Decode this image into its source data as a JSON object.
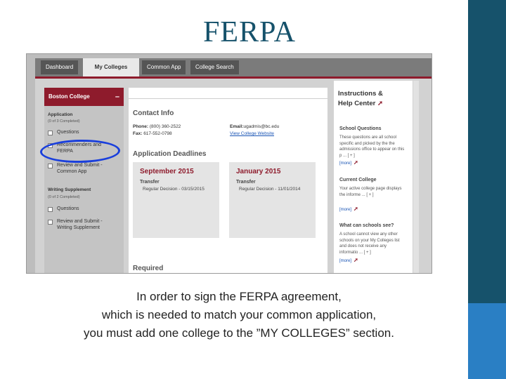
{
  "slide": {
    "title": "FERPA",
    "caption": [
      "In order to sign the FERPA agreement,",
      "which is needed to match your common application,",
      "you must add one college to the ”MY COLLEGES” section."
    ]
  },
  "nav": {
    "tabs": [
      "Dashboard",
      "My Colleges",
      "Common App",
      "College Search"
    ],
    "active_tab": "My Colleges"
  },
  "sidebar": {
    "college": "Boston College",
    "collapse_symbol": "–",
    "sections": [
      {
        "heading": "Application",
        "progress": "(0 of 3 Completed)",
        "items": [
          "Questions",
          "Recommenders and FERPA",
          "Review and Submit - Common App"
        ]
      },
      {
        "heading": "Writing Supplement",
        "progress": "(0 of 2 Completed)",
        "items": [
          "Questions",
          "Review and Submit - Writing Supplement"
        ]
      }
    ]
  },
  "main": {
    "contact_heading": "Contact Info",
    "phone_label": "Phone:",
    "phone": "(800) 360-2522",
    "fax_label": "Fax:",
    "fax": "617-552-0798",
    "email_label": "Email:",
    "email": "ugadmis@bc.edu",
    "website_link": "View College Website",
    "deadlines_heading": "Application Deadlines",
    "deadlines": [
      {
        "month": "September 2015",
        "type": "Transfer",
        "detail": "Regular Decision - 03/15/2015"
      },
      {
        "month": "January 2015",
        "type": "Transfer",
        "detail": "Regular Decision - 11/01/2014"
      }
    ],
    "required_heading": "Required"
  },
  "help": {
    "title_line1": "Instructions &",
    "title_line2": "Help Center",
    "arrow": "➚",
    "sections": [
      {
        "heading": "School Questions",
        "text": "These questions are all school specific and picked by the the admissions office to appear on this p ... [ + ]",
        "more": "[more]"
      },
      {
        "heading": "Current College",
        "text": "Your active college page displays the informe ... [ + ]",
        "more": "[more]"
      },
      {
        "heading": "What can schools see?",
        "text": "A school cannot view any other schools on your My Colleges list and does not receive any informatio ... [ + ]",
        "more": "[more]"
      }
    ]
  },
  "colors": {
    "title": "#16526b",
    "maroon": "#8e1b2c",
    "highlight_circle": "#1a3fdc",
    "side_bar": "#16526b",
    "side_bar_accent": "#2a7fc4"
  }
}
